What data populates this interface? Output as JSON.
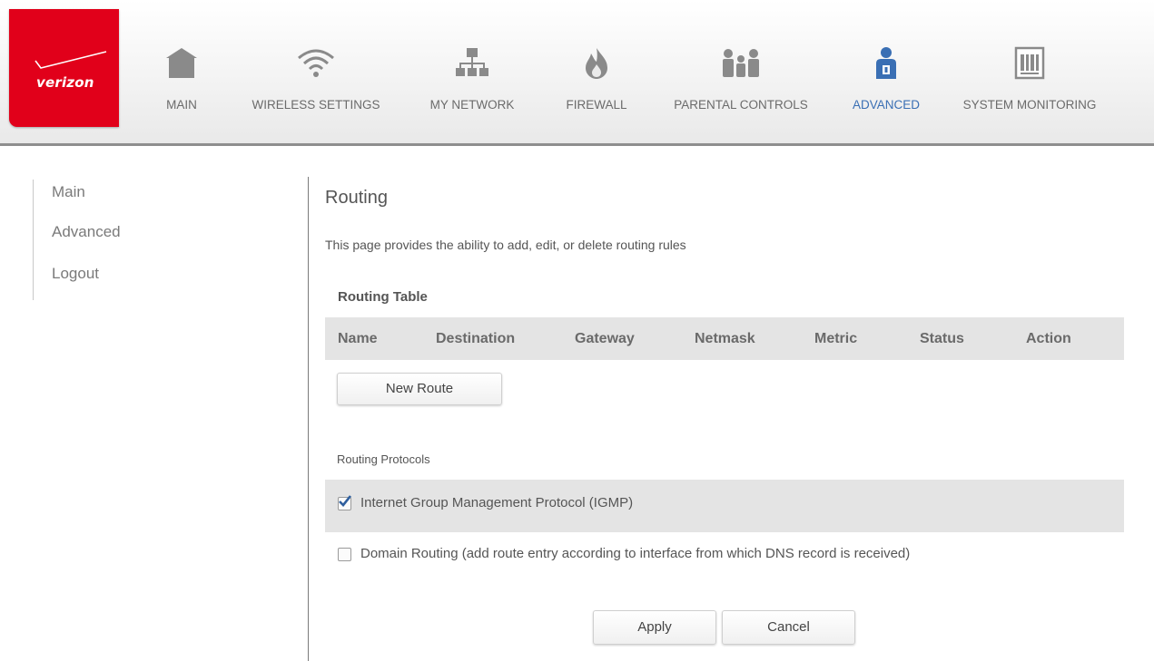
{
  "brand": {
    "logo_text": "verizon",
    "accent": "#e1001a"
  },
  "nav": {
    "active_color": "#3a6fb4",
    "items": [
      {
        "label": "MAIN",
        "icon": "home-icon"
      },
      {
        "label": "WIRELESS SETTINGS",
        "icon": "wifi-icon"
      },
      {
        "label": "MY NETWORK",
        "icon": "network-icon"
      },
      {
        "label": "FIREWALL",
        "icon": "flame-icon"
      },
      {
        "label": "PARENTAL CONTROLS",
        "icon": "family-icon"
      },
      {
        "label": "ADVANCED",
        "icon": "advanced-user-icon",
        "active": true
      },
      {
        "label": "SYSTEM MONITORING",
        "icon": "monitor-icon"
      }
    ]
  },
  "sidebar": {
    "items": [
      {
        "label": "Main"
      },
      {
        "label": "Advanced"
      },
      {
        "label": "Logout"
      }
    ]
  },
  "main": {
    "title": "Routing",
    "description": "This page provides the ability to add, edit, or delete routing rules",
    "routing_table": {
      "title": "Routing Table",
      "columns": [
        "Name",
        "Destination",
        "Gateway",
        "Netmask",
        "Metric",
        "Status",
        "Action"
      ],
      "rows": [],
      "new_route_label": "New Route"
    },
    "routing_protocols": {
      "title": "Routing Protocols",
      "items": [
        {
          "label": "Internet Group Management Protocol (IGMP)",
          "checked": true
        },
        {
          "label": "Domain Routing (add route entry according to interface from which DNS record is received)",
          "checked": false
        }
      ]
    },
    "apply_label": "Apply",
    "cancel_label": "Cancel"
  }
}
